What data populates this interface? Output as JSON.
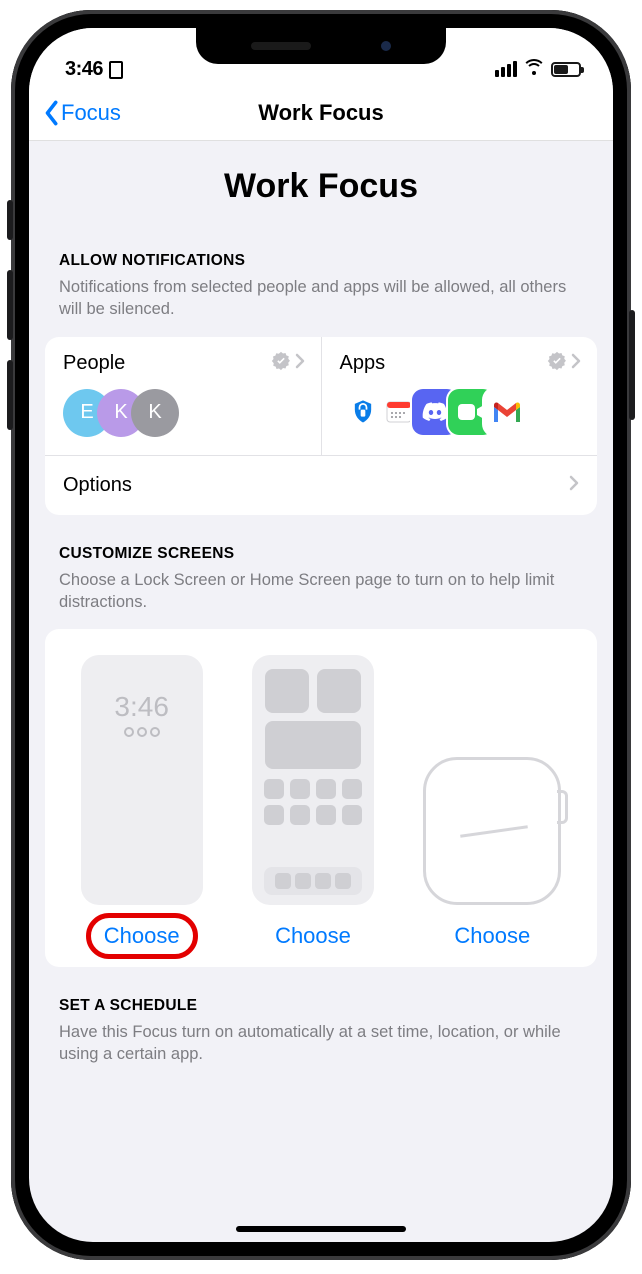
{
  "status": {
    "time": "3:46"
  },
  "nav": {
    "back": "Focus",
    "title": "Work Focus"
  },
  "page_title": "Work Focus",
  "notifications": {
    "header": "ALLOW NOTIFICATIONS",
    "sub": "Notifications from selected people and apps will be allowed, all others will be silenced.",
    "people_label": "People",
    "apps_label": "Apps",
    "people_initials": [
      "E",
      "K",
      "K"
    ],
    "options_label": "Options"
  },
  "customize": {
    "header": "CUSTOMIZE SCREENS",
    "sub": "Choose a Lock Screen or Home Screen page to turn on to help limit distractions.",
    "lock_time": "3:46",
    "choose_label": "Choose"
  },
  "schedule": {
    "header": "SET A SCHEDULE",
    "sub": "Have this Focus turn on automatically at a set time, location, or while using a certain app."
  },
  "colors": {
    "accent": "#007aff",
    "highlight": "#e30000"
  }
}
